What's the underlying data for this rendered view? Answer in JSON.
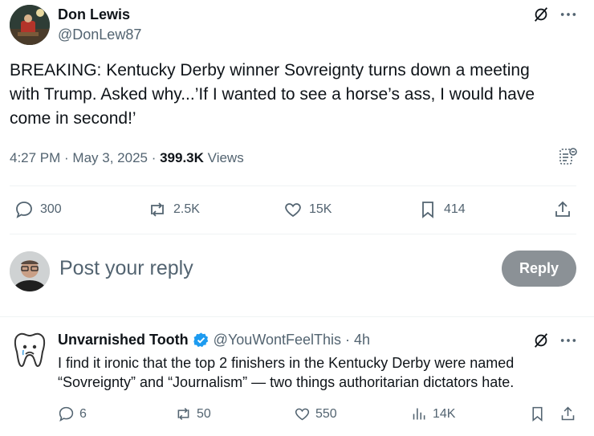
{
  "tweet": {
    "author_name": "Don Lewis",
    "author_handle": "@DonLew87",
    "text_lines": [
      "BREAKING: Kentucky Derby winner Sovreignty turns down a meeting",
      "with Trump. Asked why...’If I wanted to see a horse’s ass, I would have",
      "come in second!’"
    ],
    "time": "4:27 PM",
    "date": "May 3, 2025",
    "views_count": "399.3K",
    "views_label": "Views",
    "stats": {
      "replies": "300",
      "reposts": "2.5K",
      "likes": "15K",
      "bookmarks": "414"
    }
  },
  "composer": {
    "placeholder": "Post your reply",
    "button_label": "Reply"
  },
  "reply": {
    "author_name": "Unvarnished Tooth",
    "author_handle": "@YouWontFeelThis",
    "time_ago": "4h",
    "text_lines": [
      "I find it ironic that the top 2 finishers in the Kentucky Derby were named",
      "“Sovreignty” and “Journalism” — two things authoritarian dictators hate."
    ],
    "stats": {
      "replies": "6",
      "reposts": "50",
      "likes": "550",
      "views": "14K"
    }
  },
  "colors": {
    "text_primary": "#0f1419",
    "text_secondary": "#536471",
    "verified_blue": "#1d9bf0",
    "reply_button_bg": "#8b9196",
    "divider": "#eff3f4"
  }
}
